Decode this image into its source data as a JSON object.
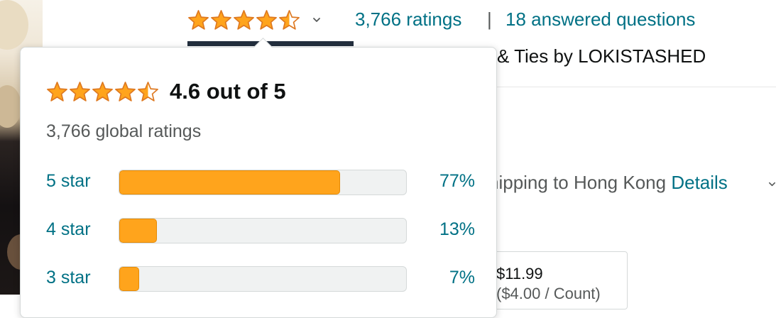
{
  "header": {
    "rating_value": 4.5,
    "ratings_link": "3,766 ratings",
    "separator": "|",
    "answered_link": "18 answered questions"
  },
  "product": {
    "byline_text": "& Ties by LOKISTASHED",
    "shipping_text": "hipping to Hong Kong",
    "shipping_details": "Details",
    "price_line1": "$11.99",
    "price_line2": "($4.00 / Count)"
  },
  "popover": {
    "rating_value": 4.5,
    "score_text": "4.6 out of 5",
    "global_ratings": "3,766 global ratings",
    "histogram": [
      {
        "label": "5 star",
        "percent_text": "77%",
        "fraction": 0.77
      },
      {
        "label": "4 star",
        "percent_text": "13%",
        "fraction": 0.13
      },
      {
        "label": "3 star",
        "percent_text": "7%",
        "fraction": 0.07
      }
    ]
  },
  "colors": {
    "star": "#ffa41c",
    "star_stroke": "#de7921",
    "link": "#007185",
    "bar_fill": "#ffa41c",
    "bar_track": "#f0f2f2"
  },
  "icons": {
    "star_full": "star-full-icon",
    "star_half": "star-half-icon",
    "chevron": "chevron-down-icon"
  }
}
